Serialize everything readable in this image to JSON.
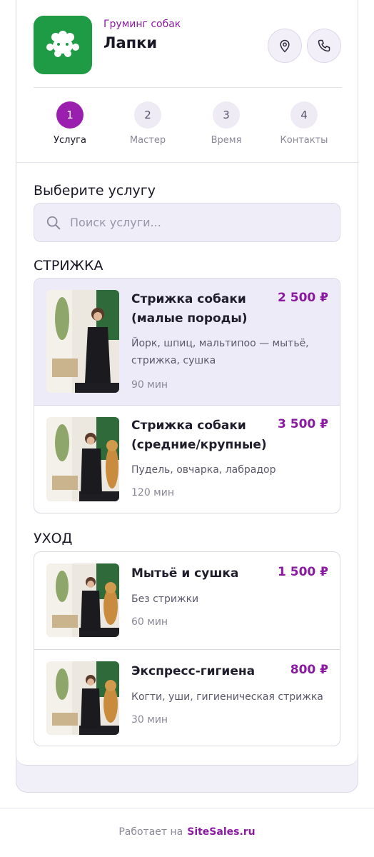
{
  "header": {
    "subtitle": "Груминг собак",
    "title": "Лапки",
    "logo_icon": "paw-icon",
    "location_icon": "map-pin-icon",
    "phone_icon": "phone-icon",
    "accent_color": "#8a1aa0"
  },
  "steps": [
    {
      "num": "1",
      "label": "Услуга",
      "active": true
    },
    {
      "num": "2",
      "label": "Мастер",
      "active": false
    },
    {
      "num": "3",
      "label": "Время",
      "active": false
    },
    {
      "num": "4",
      "label": "Контакты",
      "active": false
    }
  ],
  "main": {
    "heading": "Выберите услугу",
    "search_placeholder": "Поиск услуги..."
  },
  "groups": [
    {
      "title": "СТРИЖКА",
      "items": [
        {
          "name": "Стрижка собаки (малые породы)",
          "price": "2 500 ₽",
          "desc": "Йорк, шпиц, мальтипоо — мытьё, стрижка, сушка",
          "duration": "90 мин",
          "selected": true
        },
        {
          "name": "Стрижка собаки (средние/крупные)",
          "price": "3 500 ₽",
          "desc": "Пудель, овчарка, лабрадор",
          "duration": "120 мин",
          "selected": false
        }
      ]
    },
    {
      "title": "УХОД",
      "items": [
        {
          "name": "Мытьё и сушка",
          "price": "1 500 ₽",
          "desc": "Без стрижки",
          "duration": "60 мин",
          "selected": false
        },
        {
          "name": "Экспресс-гигиена",
          "price": "800 ₽",
          "desc": "Когти, уши, гигиеническая стрижка",
          "duration": "30 мин",
          "selected": false
        }
      ]
    }
  ],
  "footer": {
    "prefix": "Работает на",
    "brand": "SiteSales.ru"
  }
}
